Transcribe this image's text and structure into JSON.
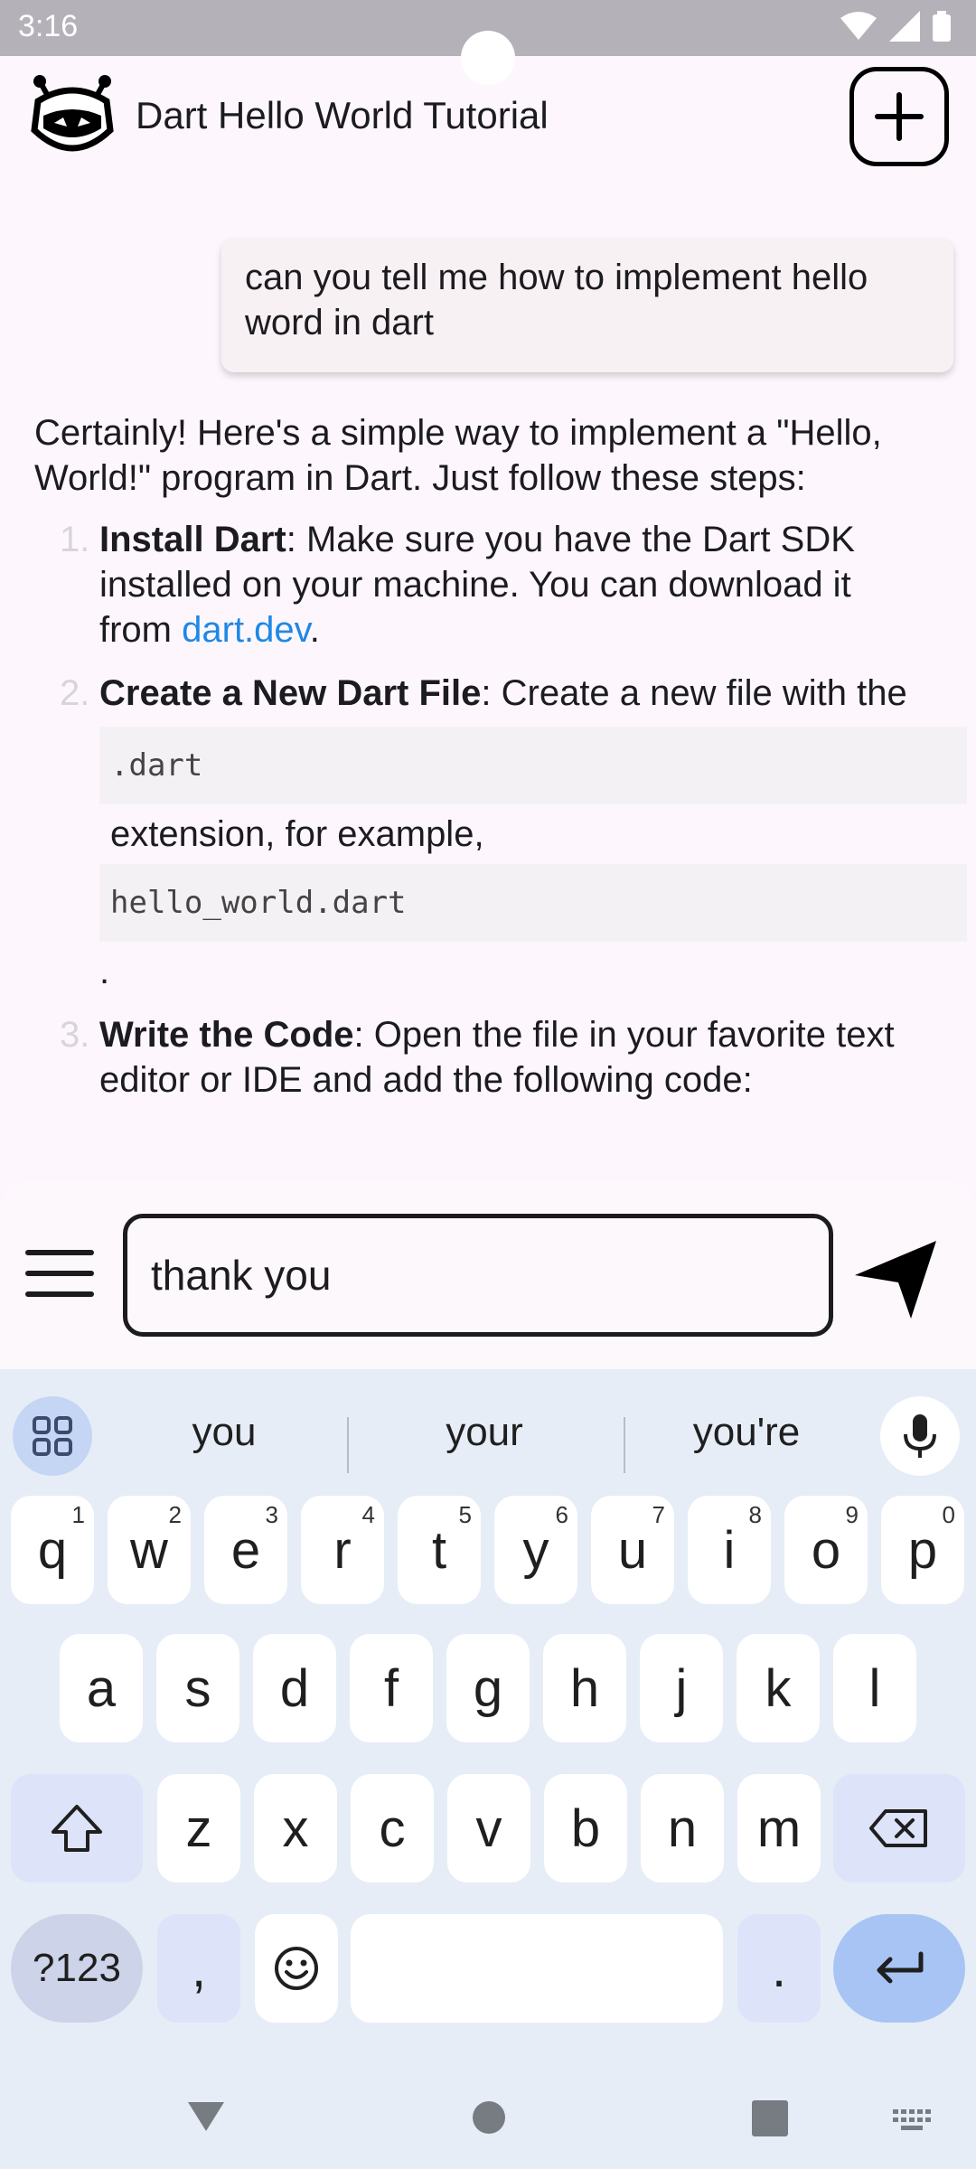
{
  "status_bar": {
    "time": "3:16"
  },
  "app_bar": {
    "title": "Dart Hello World Tutorial"
  },
  "chat": {
    "user_message": "can you tell me how to implement hello word in dart",
    "reply": {
      "intro": "Certainly! Here's a simple way to implement a \"Hello, World!\" program in Dart. Just follow these steps:",
      "steps": [
        {
          "number": "1.",
          "heading": "Install Dart",
          "text": ": Make sure you have the Dart SDK installed on your machine. You can download it from ",
          "link": "dart.dev",
          "tail": "."
        },
        {
          "number": "2.",
          "heading": "Create a New Dart File",
          "text": ": Create a new file with the",
          "code1": ".dart",
          "middle": "extension, for example,",
          "code2": "hello_world.dart",
          "tail": "."
        },
        {
          "number": "3.",
          "heading": "Write the Code",
          "text": ": Open the file in your favorite text editor or IDE and add the following code:"
        }
      ]
    }
  },
  "composer": {
    "input_value": "thank you"
  },
  "keyboard": {
    "suggestions": [
      "you",
      "your",
      "you're"
    ],
    "row1": [
      {
        "k": "q",
        "h": "1"
      },
      {
        "k": "w",
        "h": "2"
      },
      {
        "k": "e",
        "h": "3"
      },
      {
        "k": "r",
        "h": "4"
      },
      {
        "k": "t",
        "h": "5"
      },
      {
        "k": "y",
        "h": "6"
      },
      {
        "k": "u",
        "h": "7"
      },
      {
        "k": "i",
        "h": "8"
      },
      {
        "k": "o",
        "h": "9"
      },
      {
        "k": "p",
        "h": "0"
      }
    ],
    "row2": [
      "a",
      "s",
      "d",
      "f",
      "g",
      "h",
      "j",
      "k",
      "l"
    ],
    "row3": [
      "z",
      "x",
      "c",
      "v",
      "b",
      "n",
      "m"
    ],
    "symbols_label": "?123",
    "comma": ",",
    "period": "."
  },
  "colors": {
    "accent": "#1e88e5",
    "enter_key": "#a8c4f4",
    "app_bg": "#fdf7fd"
  }
}
